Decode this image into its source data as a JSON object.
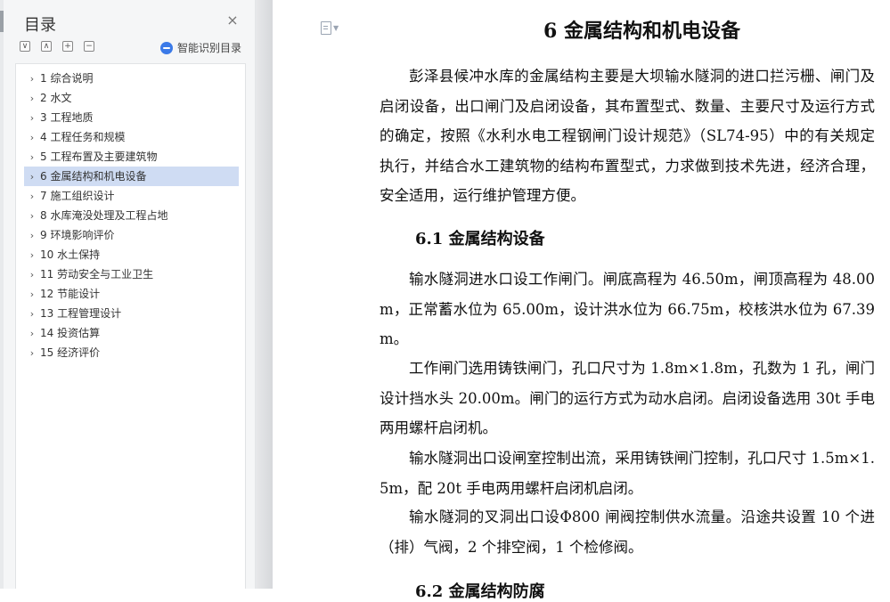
{
  "toc": {
    "title": "目录",
    "close_icon": "×",
    "smart_label": "智能识别目录",
    "tools": [
      "∨",
      "∧",
      "+",
      "−"
    ],
    "items": [
      {
        "label": "1 综合说明"
      },
      {
        "label": "2 水文"
      },
      {
        "label": "3 工程地质"
      },
      {
        "label": "4 工程任务和规模"
      },
      {
        "label": "5 工程布置及主要建筑物"
      },
      {
        "label": "6 金属结构和机电设备",
        "active": true
      },
      {
        "label": "7 施工组织设计"
      },
      {
        "label": "8 水库淹没处理及工程占地"
      },
      {
        "label": "9 环境影响评价"
      },
      {
        "label": "10 水土保持"
      },
      {
        "label": "11 劳动安全与工业卫生"
      },
      {
        "label": "12 节能设计"
      },
      {
        "label": "13 工程管理设计"
      },
      {
        "label": "14 投资估算"
      },
      {
        "label": "15 经济评价"
      }
    ]
  },
  "document": {
    "heading": "6 金属结构和机电设备",
    "intro": "彭泽县候冲水库的金属结构主要是大坝输水隧洞的进口拦污栅、闸门及启闭设备，出口闸门及启闭设备，其布置型式、数量、主要尺寸及运行方式的确定，按照《水利水电工程钢闸门设计规范》（SL74-95）中的有关规定执行，并结合水工建筑物的结构布置型式，力求做到技术先进，经济合理，安全适用，运行维护管理方便。",
    "section_heading": "6.1 金属结构设备",
    "paragraphs": [
      "输水隧洞进水口设工作闸门。闸底高程为 46.50m，闸顶高程为 48.00m，正常蓄水位为 65.00m，设计洪水位为 66.75m，校核洪水位为 67.39m。",
      "工作闸门选用铸铁闸门，孔口尺寸为 1.8m×1.8m，孔数为 1 孔，闸门设计挡水头 20.00m。闸门的运行方式为动水启闭。启闭设备选用 30t 手电两用螺杆启闭机。",
      "输水隧洞出口设闸室控制出流，采用铸铁闸门控制，孔口尺寸 1.5m×1.5m，配 20t 手电两用螺杆启闭机启闭。",
      "输水隧洞的叉洞出口设Φ800 闸阀控制供水流量。沿途共设置 10 个进（排）气阀，2 个排空阀，1 个检修阀。"
    ],
    "next_heading": "6.2 金属结构防腐"
  }
}
